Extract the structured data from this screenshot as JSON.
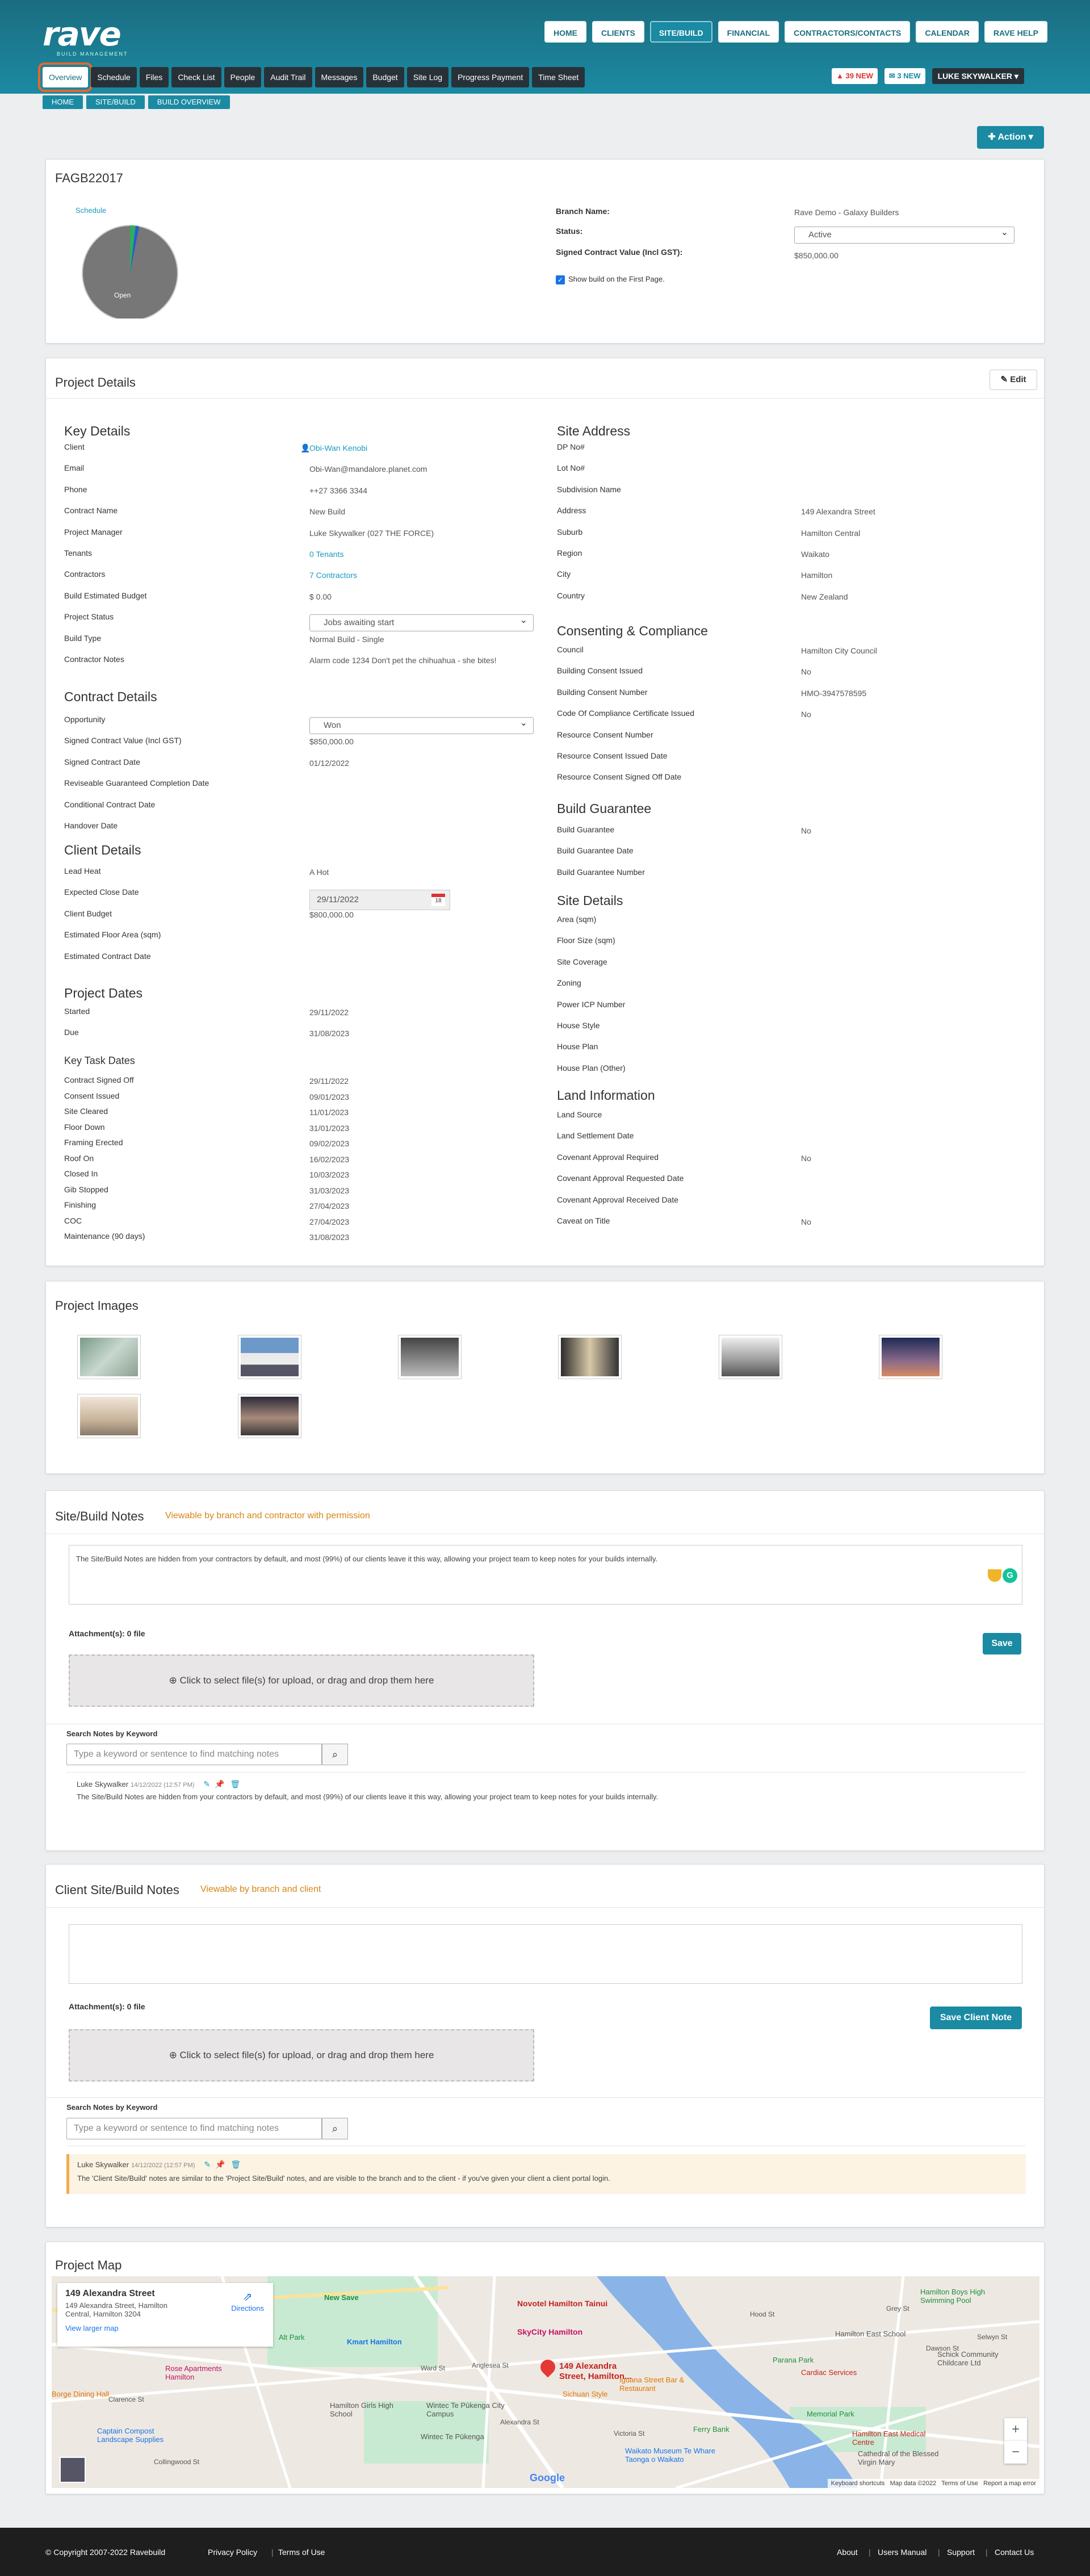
{
  "header": {
    "logo_text": "rave",
    "logo_sub": "BUILD MANAGEMENT",
    "nav": [
      "HOME",
      "CLIENTS",
      "SITE/BUILD",
      "FINANCIAL",
      "CONTRACTORS/CONTACTS",
      "CALENDAR",
      "RAVE HELP"
    ],
    "active_nav": "SITE/BUILD",
    "subnav": [
      "Overview",
      "Schedule",
      "Files",
      "Check List",
      "People",
      "Audit Trail",
      "Messages",
      "Budget",
      "Site Log",
      "Progress Payment",
      "Time Sheet"
    ],
    "badge_new": "39 NEW",
    "badge_msg": "3 NEW",
    "user": "LUKE SKYWALKER"
  },
  "breadcrumb": [
    "HOME",
    "SITE/BUILD",
    "BUILD OVERVIEW"
  ],
  "action_label": "Action",
  "summary": {
    "code": "FAGB22017",
    "pie_label_schedule": "Schedule",
    "pie_label_open": "Open",
    "branch_label": "Branch Name:",
    "branch_value": "Rave Demo - Galaxy Builders",
    "status_label": "Status:",
    "status_value": "Active",
    "contract_label": "Signed Contract Value (Incl GST):",
    "contract_value": "$850,000.00",
    "show_build_label": "Show build on the First Page."
  },
  "project": {
    "title": "Project Details",
    "edit_label": "Edit",
    "key_details": {
      "heading": "Key Details",
      "rows": [
        [
          "Client",
          "Obi-Wan Kenobi"
        ],
        [
          "Email",
          "Obi-Wan@mandalore.planet.com"
        ],
        [
          "Phone",
          "++27 3366 3344"
        ],
        [
          "Contract Name",
          "New Build"
        ],
        [
          "Project Manager",
          "Luke Skywalker (027 THE FORCE)"
        ],
        [
          "Tenants",
          "0 Tenants"
        ],
        [
          "Contractors",
          "7 Contractors"
        ],
        [
          "Build Estimated Budget",
          "$ 0.00"
        ],
        [
          "Project Status",
          "Jobs awaiting start"
        ],
        [
          "Build Type",
          "Normal Build - Single"
        ],
        [
          "Contractor Notes",
          "Alarm code 1234 Don't pet the chihuahua - she bites!"
        ]
      ]
    },
    "contract_details": {
      "heading": "Contract Details",
      "rows": [
        [
          "Opportunity",
          "Won"
        ],
        [
          "Signed Contract Value (Incl GST)",
          "$850,000.00"
        ],
        [
          "Signed Contract Date",
          "01/12/2022"
        ],
        [
          "Reviseable Guaranteed Completion Date",
          ""
        ],
        [
          "Conditional Contract Date",
          ""
        ],
        [
          "Handover Date",
          ""
        ]
      ]
    },
    "client_details": {
      "heading": "Client Details",
      "rows": [
        [
          "Lead Heat",
          "A Hot"
        ],
        [
          "Expected Close Date",
          "29/11/2022"
        ],
        [
          "Client Budget",
          "$800,000.00"
        ],
        [
          "Estimated Floor Area (sqm)",
          ""
        ],
        [
          "Estimated Contract Date",
          ""
        ]
      ],
      "calendar_day": "18"
    },
    "project_dates": {
      "heading": "Project Dates",
      "rows": [
        [
          "Started",
          "29/11/2022"
        ],
        [
          "Due",
          "31/08/2023"
        ]
      ]
    },
    "key_task_dates": {
      "heading": "Key Task Dates",
      "rows": [
        [
          "Contract Signed Off",
          "29/11/2022"
        ],
        [
          "Consent Issued",
          "09/01/2023"
        ],
        [
          "Site Cleared",
          "11/01/2023"
        ],
        [
          "Floor Down",
          "31/01/2023"
        ],
        [
          "Framing Erected",
          "09/02/2023"
        ],
        [
          "Roof On",
          "16/02/2023"
        ],
        [
          "Closed In",
          "10/03/2023"
        ],
        [
          "Gib Stopped",
          "31/03/2023"
        ],
        [
          "Finishing",
          "27/04/2023"
        ],
        [
          "COC",
          "27/04/2023"
        ],
        [
          "Maintenance (90 days)",
          "31/08/2023"
        ]
      ]
    },
    "site_address": {
      "heading": "Site Address",
      "rows": [
        [
          "DP No#",
          ""
        ],
        [
          "Lot No#",
          ""
        ],
        [
          "Subdivision Name",
          ""
        ],
        [
          "Address",
          "149 Alexandra Street"
        ],
        [
          "Suburb",
          "Hamilton Central"
        ],
        [
          "Region",
          "Waikato"
        ],
        [
          "City",
          "Hamilton"
        ],
        [
          "Country",
          "New Zealand"
        ]
      ]
    },
    "consenting": {
      "heading": "Consenting & Compliance",
      "rows": [
        [
          "Council",
          "Hamilton City Council"
        ],
        [
          "Building Consent Issued",
          "No"
        ],
        [
          "Building Consent Number",
          "HMO-3947578595"
        ],
        [
          "Code Of Compliance Certificate Issued",
          "No"
        ],
        [
          "Resource Consent Number",
          ""
        ],
        [
          "Resource Consent Issued Date",
          ""
        ],
        [
          "Resource Consent Signed Off Date",
          ""
        ]
      ]
    },
    "guarantee": {
      "heading": "Build Guarantee",
      "rows": [
        [
          "Build Guarantee",
          "No"
        ],
        [
          "Build Guarantee Date",
          ""
        ],
        [
          "Build Guarantee Number",
          ""
        ]
      ]
    },
    "site_details": {
      "heading": "Site Details",
      "rows": [
        [
          "Area (sqm)",
          ""
        ],
        [
          "Floor Size (sqm)",
          ""
        ],
        [
          "Site Coverage",
          ""
        ],
        [
          "Zoning",
          ""
        ],
        [
          "Power ICP Number",
          ""
        ],
        [
          "House Style",
          ""
        ],
        [
          "House Plan",
          ""
        ],
        [
          "House Plan (Other)",
          ""
        ]
      ]
    },
    "land": {
      "heading": "Land Information",
      "rows": [
        [
          "Land Source",
          ""
        ],
        [
          "Land Settlement Date",
          ""
        ],
        [
          "Covenant Approval Required",
          "No"
        ],
        [
          "Covenant Approval Requested Date",
          ""
        ],
        [
          "Covenant Approval Received Date",
          ""
        ],
        [
          "Caveat on Title",
          "No"
        ]
      ]
    }
  },
  "images": {
    "title": "Project Images"
  },
  "notes": {
    "title": "Site/Build Notes",
    "subtitle": "Viewable by branch and contractor with permission",
    "editor_text": "The Site/Build Notes are hidden from your contractors by default, and most (99%) of our clients leave it this way, allowing your project team to keep notes for your builds internally.",
    "attachments": "Attachment(s): 0 file",
    "save": "Save",
    "dropzone": "Click to select file(s) for upload, or drag and drop them here",
    "search_label": "Search Notes by Keyword",
    "search_placeholder": "Type a keyword or sentence to find matching notes",
    "entry_author": "Luke Skywalker",
    "entry_date": "14/12/2022 (12:57 PM)",
    "entry_text": "The Site/Build Notes are hidden from your contractors by default, and most (99%) of our clients leave it this way, allowing your project team to keep notes for your builds internally."
  },
  "client_notes": {
    "title": "Client Site/Build Notes",
    "subtitle": "Viewable by branch and client",
    "attachments": "Attachment(s): 0 file",
    "save": "Save Client Note",
    "dropzone": "Click to select file(s) for upload, or drag and drop them here",
    "search_label": "Search Notes by Keyword",
    "search_placeholder": "Type a keyword or sentence to find matching notes",
    "entry_author": "Luke Skywalker",
    "entry_date": "14/12/2022 (12:57 PM)",
    "entry_text": "The 'Client Site/Build' notes are similar to the 'Project Site/Build' notes, and are visible to the branch and to the client - if you've given your client a client portal login."
  },
  "map": {
    "title": "Project Map",
    "card_title": "149 Alexandra Street",
    "card_addr1": "149 Alexandra Street, Hamilton",
    "card_addr2": "Central, Hamilton 3204",
    "larger_map": "View larger map",
    "directions": "Directions",
    "marker_label1": "149 Alexandra",
    "marker_label2": "Street, Hamilton...",
    "places": [
      "New Save",
      "Kmart Hamilton",
      "Novotel Hamilton Tainui",
      "SkyCity Hamilton",
      "Hamilton Boys High Swimming Pool",
      "Hamilton East School",
      "Parana Park",
      "Cardiac Services",
      "Schick Community Childcare Ltd",
      "Rose Apartments Hamilton",
      "Hamilton Girls High School",
      "Wintec Te Pūkenga City Campus",
      "Sichuan Style",
      "Iguana Street Bar & Restaurant",
      "Memorial Park",
      "Hamilton East Medical Centre",
      "Cathedral of the Blessed Virgin Mary",
      "Captain Compost Landscape Supplies",
      "Wintec Te Pūkenga",
      "Waikato Museum Te Whare Taonga o Waikato",
      "Ferry Bank",
      "Borge Dining Hall",
      "Alt Park"
    ],
    "roads": [
      "Ward St",
      "Anglesea St",
      "Alexandra St",
      "Victoria St",
      "Hood St",
      "Grey St",
      "Dawson St",
      "Clarence St",
      "Collingwood St",
      "Selwyn St"
    ],
    "google": "Google",
    "attribution": [
      "Keyboard shortcuts",
      "Map data ©2022",
      "Terms of Use",
      "Report a map error"
    ]
  },
  "footer": {
    "copyright": "© Copyright 2007-2022 Ravebuild",
    "left_links": [
      "Privacy Policy",
      "Terms of Use"
    ],
    "right_links": [
      "About",
      "Users Manual",
      "Support",
      "Contact Us"
    ]
  }
}
